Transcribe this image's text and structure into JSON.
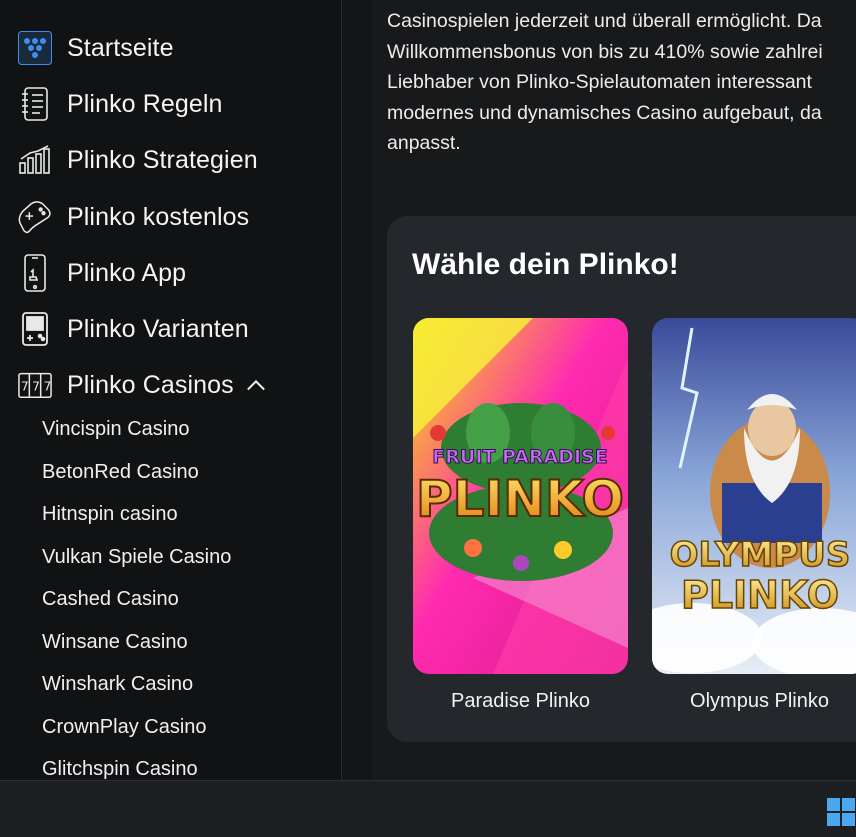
{
  "sidebar": {
    "items": [
      {
        "label": "Startseite",
        "icon": "plinko-logo-icon"
      },
      {
        "label": "Plinko Regeln",
        "icon": "rules-notebook-icon"
      },
      {
        "label": "Plinko Strategien",
        "icon": "bar-chart-icon"
      },
      {
        "label": "Plinko kostenlos",
        "icon": "gamepad-icon"
      },
      {
        "label": "Plinko App",
        "icon": "smartphone-icon"
      },
      {
        "label": "Plinko Varianten",
        "icon": "handheld-console-icon"
      },
      {
        "label": "Plinko Casinos",
        "icon": "slot-machine-icon",
        "expanded": true
      }
    ],
    "casinos": [
      "Vincispin Casino",
      "BetonRed Casino",
      "Hitnspin casino",
      "Vulkan Spiele Casino",
      "Cashed Casino",
      "Winsane Casino",
      "Winshark Casino",
      "CrownPlay Casino",
      "Glitchspin Casino"
    ]
  },
  "main": {
    "intro_lines": [
      "Casinospielen jederzeit und überall ermöglicht. Da",
      "Willkommensbonus von bis zu 410% sowie zahlrei",
      "Liebhaber von Plinko-Spielautomaten interessant",
      "modernes und dynamisches Casino aufgebaut, da",
      "anpasst."
    ],
    "choose": {
      "title": "Wähle dein Plinko!",
      "games": [
        {
          "name": "Paradise Plinko",
          "art_top": "FRUIT PARADISE",
          "art_main": "PLINKO"
        },
        {
          "name": "Olympus Plinko",
          "art_top": "OLYMPUS",
          "art_main": "PLINKO"
        }
      ]
    }
  },
  "colors": {
    "accent_blue": "#3d8ef0",
    "card_bg": "#24272b",
    "sidebar_bg": "#111213"
  }
}
